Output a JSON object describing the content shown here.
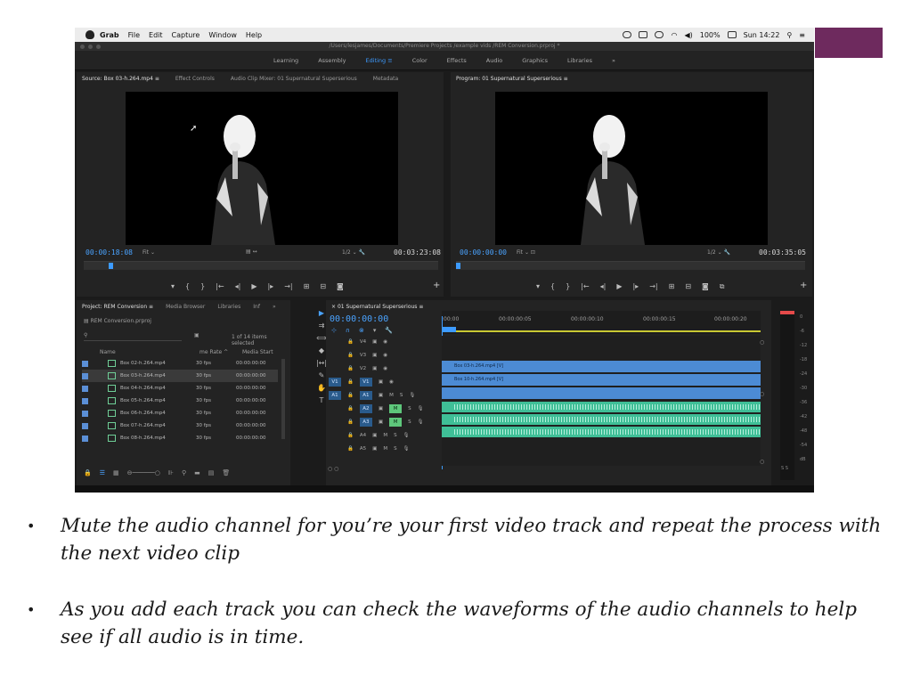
{
  "slide": {
    "accent_color": "#6e2a5e",
    "bullets": [
      "Mute the audio channel for you’re your first video track and repeat the process with the next video clip",
      "As you add each track you can check the waveforms of the audio channels to help see if all audio is in time."
    ]
  },
  "macos_menubar": {
    "app": "Grab",
    "menus": [
      "File",
      "Edit",
      "Capture",
      "Window",
      "Help"
    ],
    "battery": "100%",
    "clock": "Sun 14:22"
  },
  "window": {
    "title_path": "/Users/lesjames/Documents/Premiere Projects /example vids /REM Conversion.prproj *"
  },
  "workspaces": {
    "items": [
      "Learning",
      "Assembly",
      "Editing",
      "Color",
      "Effects",
      "Audio",
      "Graphics",
      "Libraries",
      "»"
    ],
    "active": "Editing"
  },
  "source_monitor": {
    "tabs": [
      "Source: Box 03-h.264.mp4 ≡",
      "Effect Controls",
      "Audio Clip Mixer: 01 Supernatural Superserious",
      "Metadata"
    ],
    "timecode": "00:00:18:08",
    "fit": "Fit",
    "resolution": "1/2",
    "duration": "00:03:23:08"
  },
  "program_monitor": {
    "tab": "Program: 01 Supernatural Superserious ≡",
    "timecode": "00:00:00:00",
    "fit": "Fit",
    "resolution": "1/2",
    "duration": "00:03:35:05"
  },
  "project_panel": {
    "tabs": [
      "Project: REM Conversion ≡",
      "Media Browser",
      "Libraries",
      "Inf",
      "»"
    ],
    "project_file": "REM Conversion.prproj",
    "items_selected": "1 of 14 items selected",
    "columns": [
      "Name",
      "me Rate ^",
      "Media Start"
    ],
    "rows": [
      {
        "name": "Box 02-h.264.mp4",
        "rate": "30 fps",
        "start": "00:00:00:00"
      },
      {
        "name": "Box 03-h.264.mp4",
        "rate": "30 fps",
        "start": "00:00:00:00"
      },
      {
        "name": "Box 04-h.264.mp4",
        "rate": "30 fps",
        "start": "00:00:00:00"
      },
      {
        "name": "Box 05-h.264.mp4",
        "rate": "30 fps",
        "start": "00:00:00:00"
      },
      {
        "name": "Box 06-h.264.mp4",
        "rate": "30 fps",
        "start": "00:00:00:00"
      },
      {
        "name": "Box 07-h.264.mp4",
        "rate": "30 fps",
        "start": "00:00:00:00"
      },
      {
        "name": "Box 08-h.264.mp4",
        "rate": "30 fps",
        "start": "00:00:00:00"
      }
    ]
  },
  "timeline": {
    "tab": "01 Supernatural Superserious ≡",
    "timecode": "00:00:00:00",
    "ruler": [
      ":00:00",
      "00:00:00:05",
      "00:00:00:10",
      "00:00:00:15",
      "00:00:00:20"
    ],
    "video_tracks": [
      "V4",
      "V3",
      "V2",
      "V1"
    ],
    "audio_tracks": [
      "A1",
      "A2",
      "A3",
      "A4",
      "A5"
    ],
    "clips": {
      "v3": "Box 03-h.264.mp4 [V]",
      "v2": "Box 10-h.264.mp4 [V]"
    },
    "meter_scale": [
      "0",
      "-6",
      "-12",
      "-18",
      "-24",
      "-30",
      "-36",
      "-42",
      "-48",
      "-54",
      "dB"
    ],
    "meter_footer": "S  S"
  }
}
